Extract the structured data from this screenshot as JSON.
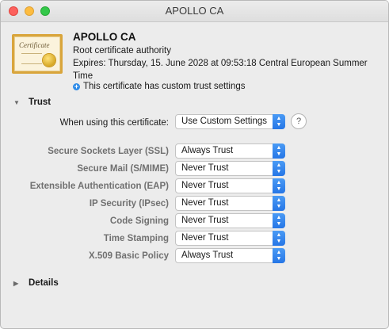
{
  "window": {
    "title": "APOLLO CA"
  },
  "certificate": {
    "icon": "certificate-icon",
    "icon_text": "Certificate",
    "name": "APOLLO CA",
    "type": "Root certificate authority",
    "expires": "Expires: Thursday, 15. June 2028 at 09:53:18 Central European Summer Time",
    "trust_note": "This certificate has custom trust settings"
  },
  "trust": {
    "header": "Trust",
    "using_label": "When using this certificate:",
    "using_value": "Use Custom Settings",
    "rows": [
      {
        "label": "Secure Sockets Layer (SSL)",
        "value": "Always Trust"
      },
      {
        "label": "Secure Mail (S/MIME)",
        "value": "Never Trust"
      },
      {
        "label": "Extensible Authentication (EAP)",
        "value": "Never Trust"
      },
      {
        "label": "IP Security (IPsec)",
        "value": "Never Trust"
      },
      {
        "label": "Code Signing",
        "value": "Never Trust"
      },
      {
        "label": "Time Stamping",
        "value": "Never Trust"
      },
      {
        "label": "X.509 Basic Policy",
        "value": "Always Trust"
      }
    ]
  },
  "details": {
    "header": "Details"
  },
  "colors": {
    "accent": "#2676e6",
    "close": "#fc615d",
    "minimize": "#fdbc40",
    "maximize": "#34c84a"
  }
}
